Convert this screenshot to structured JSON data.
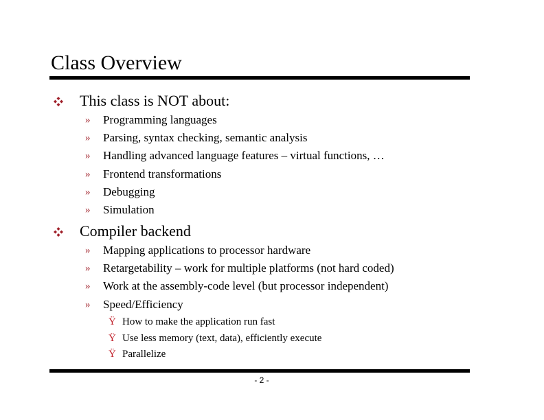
{
  "slide": {
    "title": "Class Overview",
    "page_number": "- 2 -",
    "colors": {
      "text": "#000000",
      "bullet": "#a0202a",
      "rule": "#000000"
    },
    "icons": {
      "level1_bullet": "diamond-cluster-icon",
      "level2_bullet": "»",
      "level3_bullet": "Ÿ"
    },
    "sections": [
      {
        "heading": "This class is NOT about:",
        "items": [
          {
            "text": "Programming languages"
          },
          {
            "text": "Parsing, syntax checking, semantic analysis"
          },
          {
            "text": "Handling advanced language features – virtual functions, …"
          },
          {
            "text": "Frontend transformations"
          },
          {
            "text": "Debugging"
          },
          {
            "text": "Simulation"
          }
        ]
      },
      {
        "heading": "Compiler backend",
        "items": [
          {
            "text": "Mapping applications to processor hardware"
          },
          {
            "text": "Retargetability – work for multiple platforms (not hard coded)"
          },
          {
            "text": "Work at the assembly-code level (but processor independent)"
          },
          {
            "text": "Speed/Efficiency",
            "subitems": [
              {
                "text": "How to make the application run fast"
              },
              {
                "text": "Use less memory (text, data), efficiently execute"
              },
              {
                "text": "Parallelize"
              }
            ]
          }
        ]
      }
    ]
  }
}
